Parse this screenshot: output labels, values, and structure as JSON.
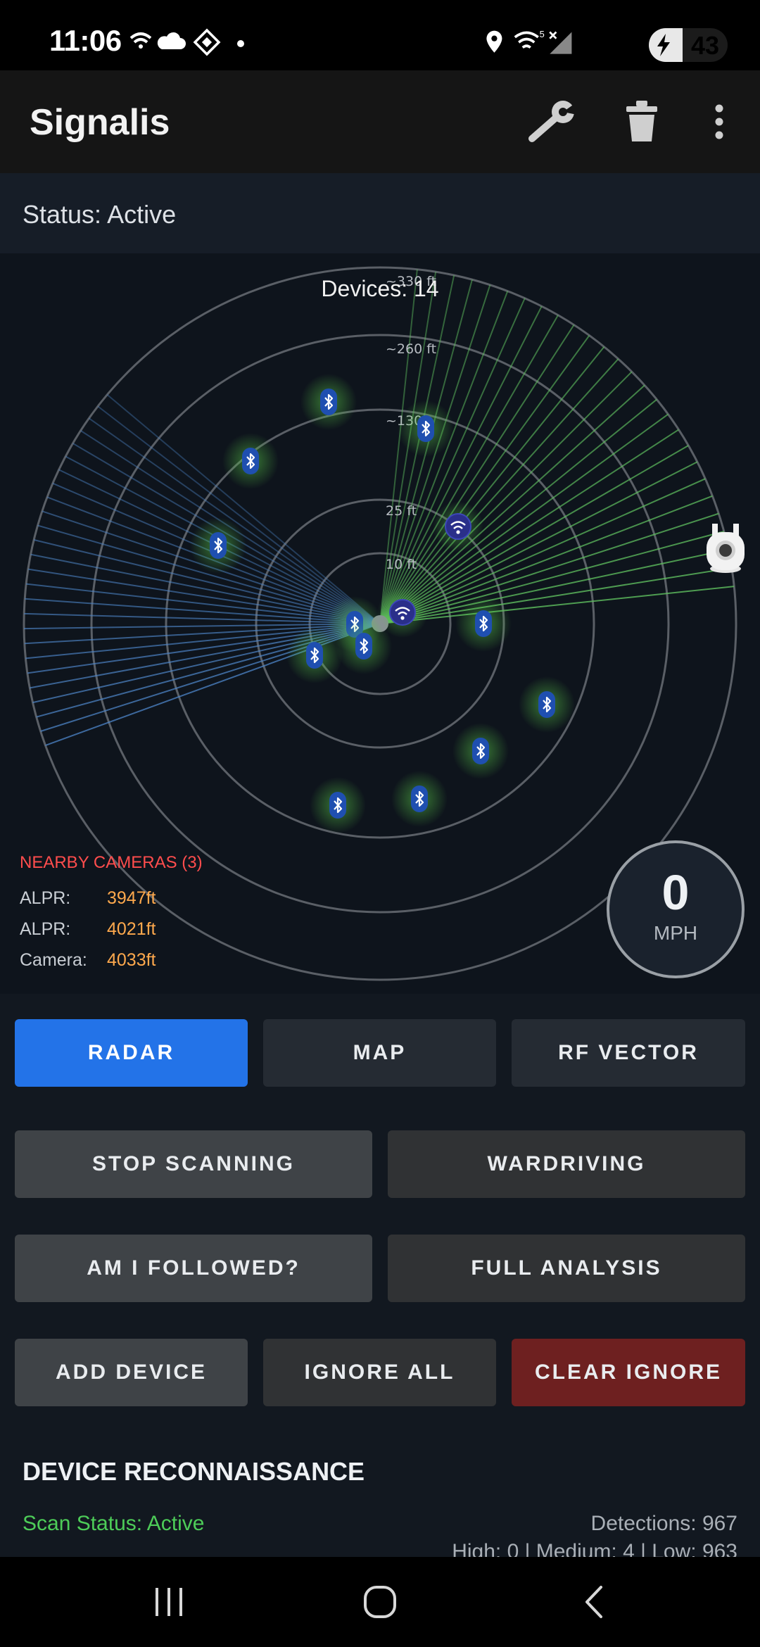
{
  "status_bar": {
    "time": "11:06",
    "battery_level": "43",
    "icons": [
      "wifi-calling-icon",
      "cloud-icon",
      "app-notification-icon",
      "dot-icon",
      "location-icon",
      "wifi-icon",
      "signal-icon",
      "charging-battery-icon"
    ]
  },
  "app_bar": {
    "title": "Signalis",
    "actions": [
      "wrench-icon",
      "trash-icon",
      "more-vert-icon"
    ]
  },
  "status": {
    "text": "Status: Active"
  },
  "radar": {
    "devices_label": "Devices: 14",
    "range_labels": [
      "10 ft",
      "25 ft",
      "~130",
      "~260 ft",
      "~330 ft"
    ],
    "accent_color": "#4caf50",
    "bluetooth_color": "#1f4fb0",
    "sweep_colors": [
      "#5fbf5f",
      "#4e86c9"
    ]
  },
  "nearby_cameras": {
    "header": "NEARBY CAMERAS (3)",
    "items": [
      {
        "label": "ALPR:",
        "distance": "3947ft"
      },
      {
        "label": "ALPR:",
        "distance": "4021ft"
      },
      {
        "label": "Camera:",
        "distance": "4033ft"
      }
    ]
  },
  "speed": {
    "value": "0",
    "unit": "MPH"
  },
  "view_tabs": [
    {
      "label": "RADAR",
      "active": true
    },
    {
      "label": "MAP",
      "active": false
    },
    {
      "label": "RF VECTOR",
      "active": false
    }
  ],
  "actions": {
    "stop_scanning": "STOP SCANNING",
    "wardriving": "WARDRIVING",
    "am_i_followed": "AM I FOLLOWED?",
    "full_analysis": "FULL ANALYSIS",
    "add_device": "ADD DEVICE",
    "ignore_all": "IGNORE ALL",
    "clear_ignore": "CLEAR IGNORE"
  },
  "recon": {
    "title": "DEVICE RECONNAISSANCE",
    "scan_status": "Scan Status: Active",
    "detections": "Detections: 967",
    "severity": "High: 0 | Medium: 4 | Low: 963"
  },
  "nav_bar": [
    "recents-icon",
    "home-icon",
    "back-icon"
  ]
}
